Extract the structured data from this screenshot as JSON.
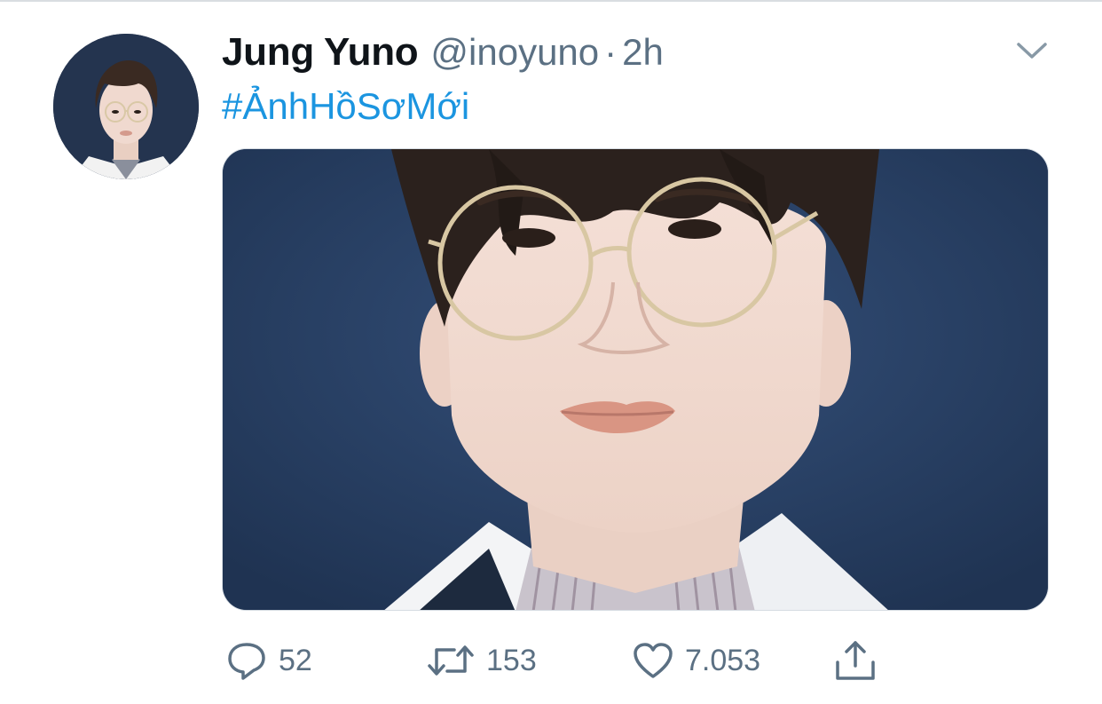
{
  "tweet": {
    "author": {
      "display_name": "Jung Yuno",
      "handle": "@inoyuno",
      "separator": "·",
      "time": "2h"
    },
    "text": "#ẢnhHồSơMới",
    "actions": {
      "replies": "52",
      "retweets": "153",
      "likes": "7.053"
    }
  },
  "icons": {
    "menu": "chevron-down-icon",
    "reply": "reply-icon",
    "retweet": "retweet-icon",
    "like": "heart-icon",
    "share": "share-icon"
  },
  "colors": {
    "link": "#1b95e0",
    "secondary_text": "#5b7083",
    "primary_text": "#0f1419",
    "photo_background": "#2b4262"
  }
}
